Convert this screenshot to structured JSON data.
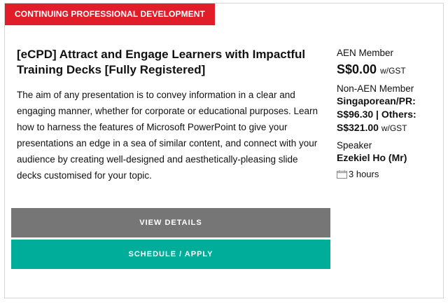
{
  "card": {
    "tag": "CONTINUING PROFESSIONAL DEVELOPMENT",
    "title": "[eCPD] Attract and Engage Learners with Impactful Training Decks [Fully Registered]",
    "description": "The aim of any presentation is to convey information in a clear and engaging manner, whether for corporate or educational purposes. Learn how to harness the features of Microsoft PowerPoint to give your presentations an edge in a sea of similar content, and connect with your audience by creating well-designed and aesthetically-pleasing slide decks customised for your topic.",
    "buttons": {
      "details": "VIEW DETAILS",
      "apply": "SCHEDULE / APPLY"
    }
  },
  "pricing": {
    "member_label": "AEN Member",
    "member_price": "S$0.00",
    "member_suffix": "w/GST",
    "nonmember_label": "Non-AEN Member",
    "nonmember_line1": "Singaporean/PR:",
    "nonmember_line2": "S$96.30 | Others:",
    "nonmember_line3": "S$321.00",
    "nonmember_suffix": "w/GST"
  },
  "speaker": {
    "label": "Speaker",
    "name": "Ezekiel Ho (Mr)"
  },
  "duration": {
    "icon": "calendar-icon",
    "text": "3 hours"
  },
  "colors": {
    "tag_bg": "#e21d2a",
    "details_button": "#767676",
    "apply_button": "#00ac9a"
  }
}
